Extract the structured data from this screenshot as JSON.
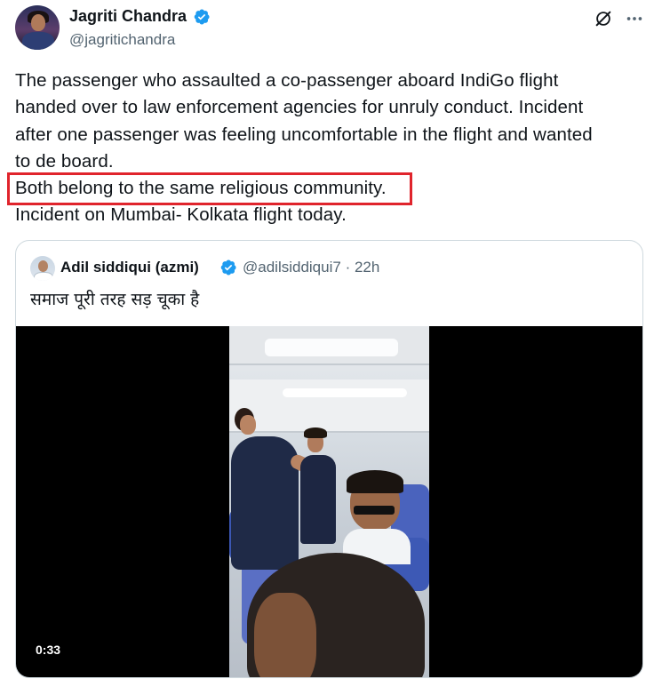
{
  "tweet": {
    "author_name": "Jagriti Chandra",
    "author_handle": "@jagritichandra",
    "verified": true,
    "lines": [
      "The passenger who assaulted a co-passenger aboard IndiGo flight",
      "handed over to law enforcement agencies for unruly conduct. Incident",
      "after one passenger was feeling uncomfortable in the flight and wanted",
      "to de board.",
      "Both belong to the same religious community.",
      "Incident on Mumbai- Kolkata flight today."
    ],
    "highlighted_line_index": 4,
    "highlight_color": "#e0242c"
  },
  "quote": {
    "author_name": "Adil siddiqui (azmi)",
    "author_handle": "@adilsiddiqui7",
    "time": "22h",
    "separator": "·",
    "verified": true,
    "text": "समाज पूरी तरह सड़ चूका है",
    "video_duration": "0:33"
  },
  "icons": {
    "verified": "verified-badge-icon",
    "grok": "grok-icon",
    "more": "more-icon"
  },
  "colors": {
    "verified_blue": "#1d9bf0",
    "text_primary": "#0f1419",
    "text_secondary": "#536471",
    "card_border": "#cfd9de"
  }
}
